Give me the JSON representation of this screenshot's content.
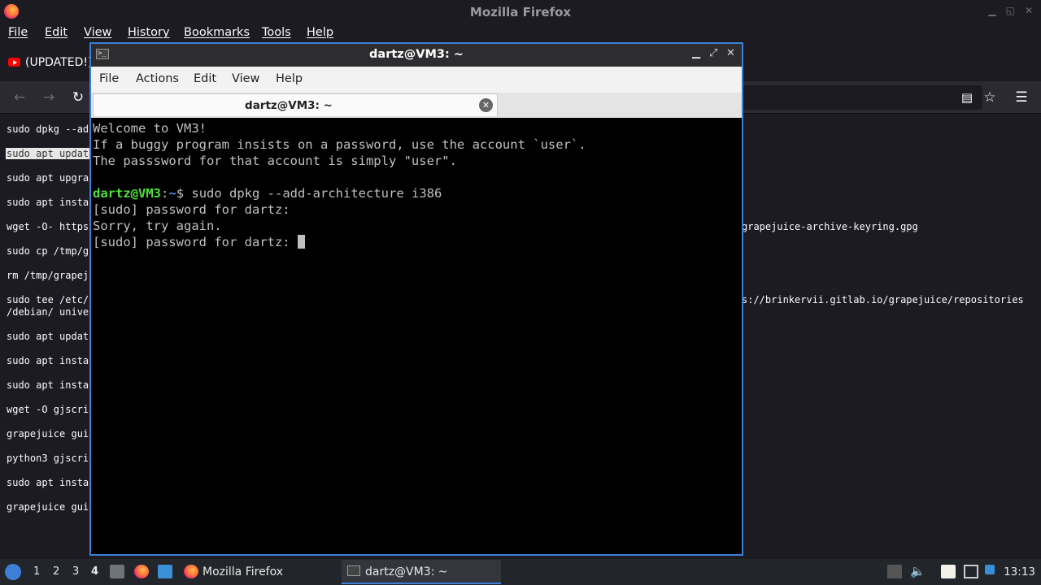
{
  "firefox": {
    "title": "Mozilla Firefox",
    "menu": [
      "File",
      "Edit",
      "View",
      "History",
      "Bookmarks",
      "Tools",
      "Help"
    ],
    "tab_label": "(UPDATED!)",
    "commands": [
      "sudo dpkg --ad",
      "sudo apt updat",
      "sudo apt upgra",
      "sudo apt insta",
      "wget -O- https",
      "sudo cp /tmp/g",
      "rm /tmp/grapej",
      "sudo tee /etc/",
      "/debian/ unive",
      "sudo apt updat",
      "sudo apt insta",
      "sudo apt insta",
      "wget -O gjscri",
      "grapejuice gui",
      "python3 gjscri",
      "sudo apt insta",
      "grapejuice gui"
    ],
    "right_text_1": "grapejuice-archive-keyring.gpg",
    "right_text_2": "s://brinkervii.gitlab.io/grapejuice/repositories"
  },
  "terminal": {
    "title": "dartz@VM3: ~",
    "menu": [
      "File",
      "Actions",
      "Edit",
      "View",
      "Help"
    ],
    "tab_label": "dartz@VM3: ~",
    "lines": [
      "Welcome to VM3!",
      "If a buggy program insists on a password, use the account `user`.",
      "The passsword for that account is simply \"user\"."
    ],
    "prompt_user": "dartz@VM3",
    "prompt_sep": ":",
    "prompt_path": "~",
    "prompt_dollar": "$ ",
    "command": "sudo dpkg --add-architecture i386",
    "output": [
      "[sudo] password for dartz:",
      "Sorry, try again.",
      "[sudo] password for dartz: "
    ]
  },
  "taskbar": {
    "desktops": [
      "1",
      "2",
      "3",
      "4"
    ],
    "active_desktop": "4",
    "tasks": [
      {
        "label": "Mozilla Firefox"
      },
      {
        "label": "dartz@VM3: ~"
      }
    ],
    "clock": "13:13"
  },
  "colors": {
    "prompt_user": "#4fe03a",
    "prompt_path": "#4a8de8",
    "accent": "#3d7fd6"
  }
}
